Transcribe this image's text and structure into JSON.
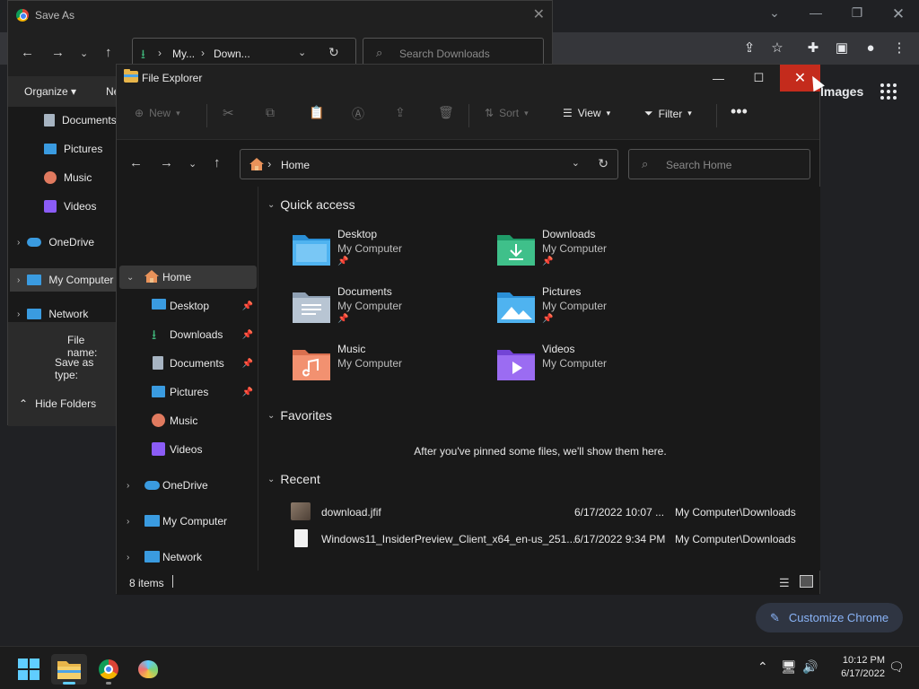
{
  "chrome": {
    "images_link": "Images",
    "customize_label": "Customize Chrome"
  },
  "save_as": {
    "title": "Save As",
    "address": [
      "My...",
      "Down..."
    ],
    "search_placeholder": "Search Downloads",
    "organize_label": "Organize",
    "new_label": "Ne",
    "tree": [
      {
        "label": "Documents",
        "icon": "documents-icon"
      },
      {
        "label": "Pictures",
        "icon": "pictures-icon"
      },
      {
        "label": "Music",
        "icon": "music-icon"
      },
      {
        "label": "Videos",
        "icon": "videos-icon"
      },
      {
        "label": "OneDrive",
        "icon": "onedrive-icon"
      },
      {
        "label": "My Computer",
        "icon": "computer-icon"
      },
      {
        "label": "Network",
        "icon": "network-icon"
      }
    ],
    "file_name_label": "File name:",
    "save_as_type_label": "Save as type:",
    "hide_folders_label": "Hide Folders"
  },
  "explorer": {
    "title": "File Explorer",
    "commands": {
      "new": "New",
      "sort": "Sort",
      "view": "View",
      "filter": "Filter"
    },
    "address": "Home",
    "search_placeholder": "Search Home",
    "sidebar": [
      {
        "label": "Home",
        "icon": "home-icon",
        "pinned": false
      },
      {
        "label": "Desktop",
        "icon": "desktop-icon",
        "pinned": true
      },
      {
        "label": "Downloads",
        "icon": "downloads-icon",
        "pinned": true
      },
      {
        "label": "Documents",
        "icon": "documents-icon",
        "pinned": true
      },
      {
        "label": "Pictures",
        "icon": "pictures-icon",
        "pinned": true
      },
      {
        "label": "Music",
        "icon": "music-icon",
        "pinned": false
      },
      {
        "label": "Videos",
        "icon": "videos-icon",
        "pinned": false
      },
      {
        "label": "OneDrive",
        "icon": "onedrive-icon",
        "pinned": false
      },
      {
        "label": "My Computer",
        "icon": "computer-icon",
        "pinned": false
      },
      {
        "label": "Network",
        "icon": "network-icon",
        "pinned": false
      }
    ],
    "quick_access_title": "Quick access",
    "quick_access": [
      {
        "name": "Desktop",
        "sub": "My Computer",
        "pinned": true,
        "icon": "desktop-folder-icon"
      },
      {
        "name": "Downloads",
        "sub": "My Computer",
        "pinned": true,
        "icon": "downloads-folder-icon"
      },
      {
        "name": "Documents",
        "sub": "My Computer",
        "pinned": true,
        "icon": "documents-folder-icon"
      },
      {
        "name": "Pictures",
        "sub": "My Computer",
        "pinned": true,
        "icon": "pictures-folder-icon"
      },
      {
        "name": "Music",
        "sub": "My Computer",
        "pinned": false,
        "icon": "music-folder-icon"
      },
      {
        "name": "Videos",
        "sub": "My Computer",
        "pinned": false,
        "icon": "videos-folder-icon"
      }
    ],
    "favorites_title": "Favorites",
    "favorites_empty": "After you've pinned some files, we'll show them here.",
    "recent_title": "Recent",
    "recent": [
      {
        "name": "download.jfif",
        "date": "6/17/2022 10:07 ...",
        "location": "My Computer\\Downloads"
      },
      {
        "name": "Windows11_InsiderPreview_Client_x64_en-us_251...",
        "date": "6/17/2022 9:34 PM",
        "location": "My Computer\\Downloads"
      }
    ],
    "status": "8 items"
  },
  "taskbar": {
    "time": "10:12 PM",
    "date": "6/17/2022"
  },
  "colors": {
    "close_red": "#c42b1c",
    "accent_blue": "#60cdff"
  }
}
